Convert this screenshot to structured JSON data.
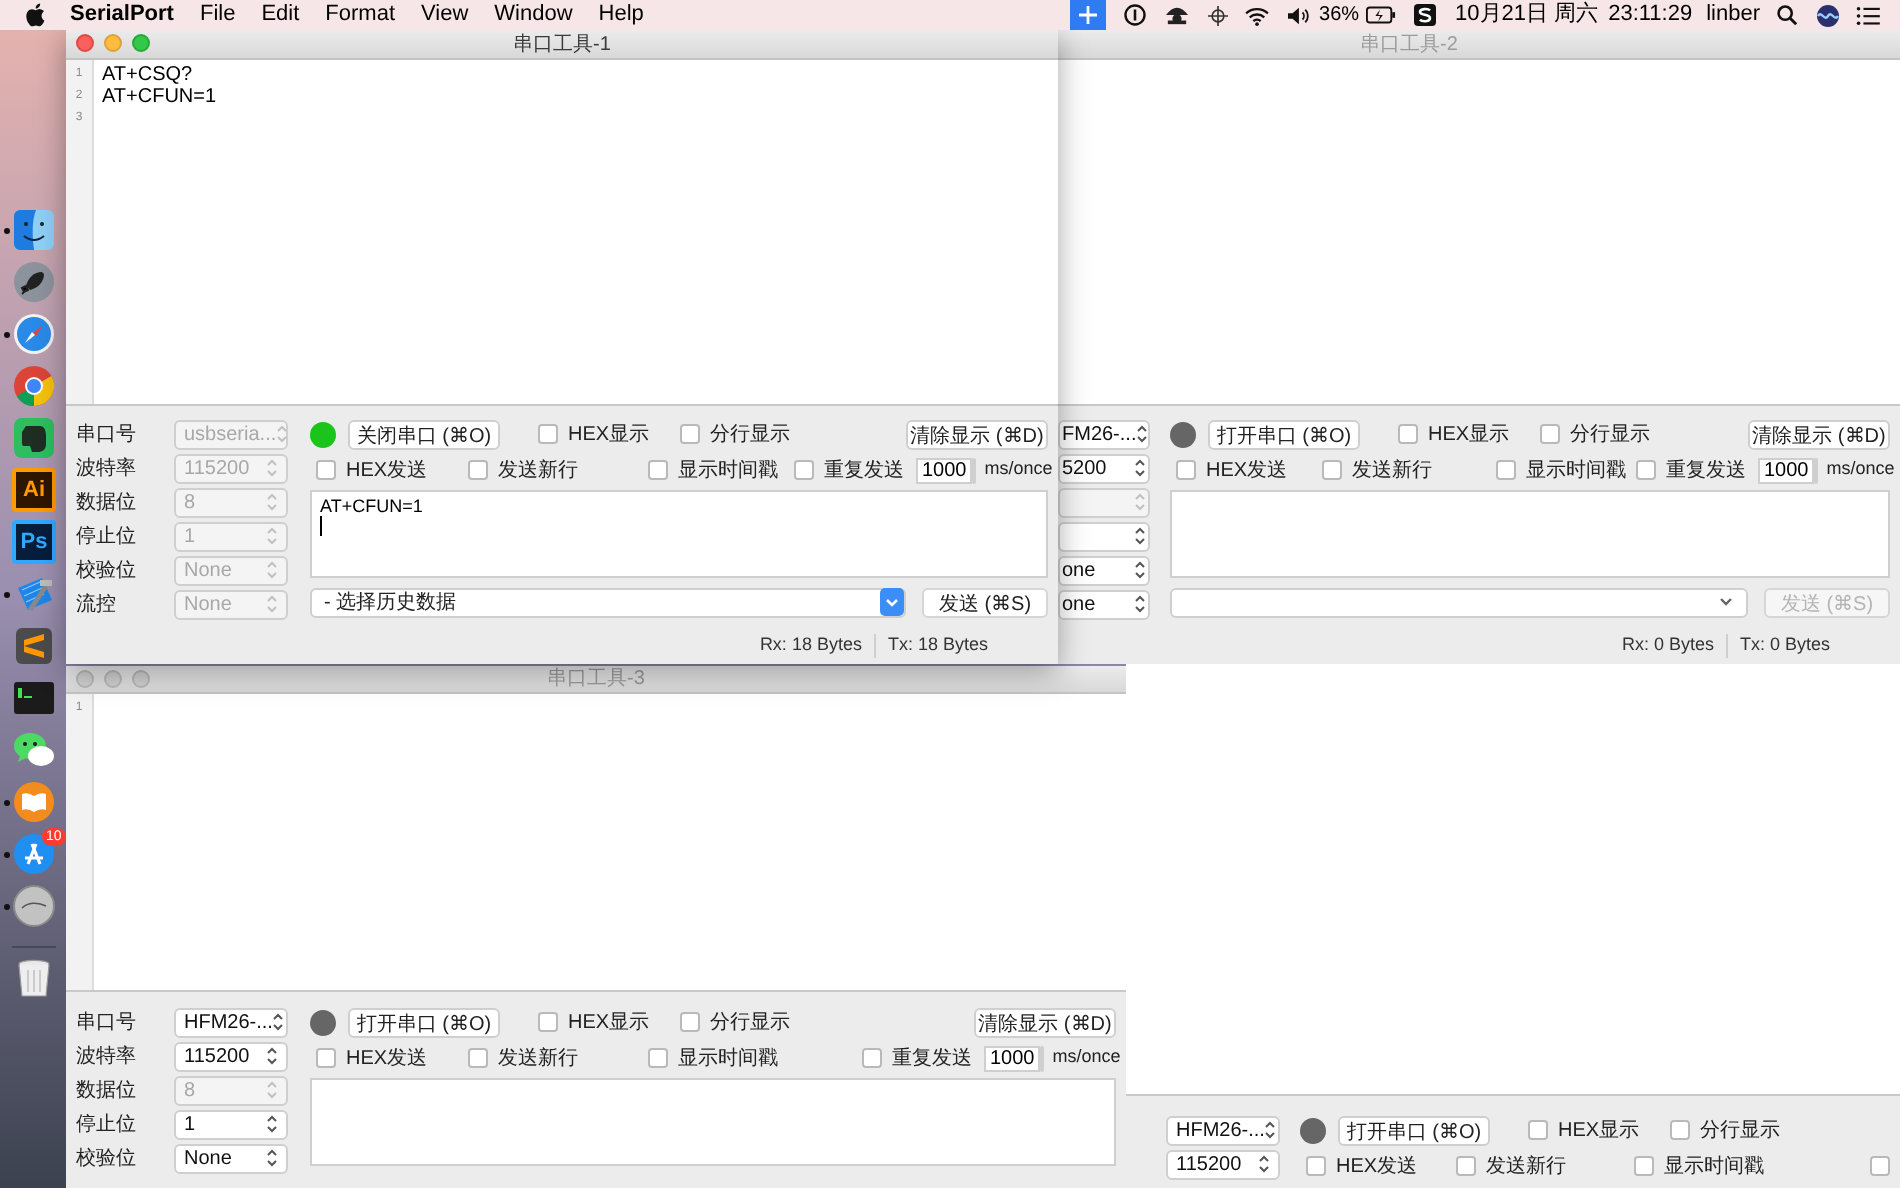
{
  "menu_bar": {
    "app_name": "SerialPort",
    "menus": [
      "File",
      "Edit",
      "Format",
      "View",
      "Window",
      "Help"
    ],
    "battery_percent": "36%",
    "date": "10月21日 周六",
    "time": "23:11:29",
    "user": "linber"
  },
  "dock": {
    "items": [
      {
        "kind": "finder",
        "running": true
      },
      {
        "kind": "launchpad",
        "running": false
      },
      {
        "kind": "safari",
        "running": true
      },
      {
        "kind": "chrome",
        "running": false
      },
      {
        "kind": "evernote",
        "running": false
      },
      {
        "kind": "illustrator",
        "label": "Ai",
        "running": false
      },
      {
        "kind": "photoshop",
        "label": "Ps",
        "running": false
      },
      {
        "kind": "xcode",
        "running": true
      },
      {
        "kind": "sublime",
        "running": false
      },
      {
        "kind": "terminal",
        "running": false
      },
      {
        "kind": "wechat",
        "running": false
      },
      {
        "kind": "books",
        "running": true
      },
      {
        "kind": "appstore",
        "running": true,
        "badge": "10"
      },
      {
        "kind": "serialport",
        "running": true
      },
      {
        "kind": "trash",
        "running": false
      }
    ]
  },
  "windows": [
    {
      "title": "串口工具-1",
      "active": true,
      "editor": {
        "line_numbers": [
          "1",
          "2",
          "3"
        ],
        "lines": [
          "AT+CSQ?",
          "AT+CFUN=1"
        ]
      },
      "settings": [
        {
          "label": "串口号",
          "value": "usbseria...",
          "disabled": true
        },
        {
          "label": "波特率",
          "value": "115200",
          "disabled": true
        },
        {
          "label": "数据位",
          "value": "8",
          "disabled": true
        },
        {
          "label": "停止位",
          "value": "1",
          "disabled": true
        },
        {
          "label": "校验位",
          "value": "None",
          "disabled": true
        },
        {
          "label": "流控",
          "value": "None",
          "disabled": true
        }
      ],
      "port_open": true,
      "port_button": "关闭串口 (⌘O)",
      "display_options": [
        {
          "label": "HEX显示",
          "checked": false
        },
        {
          "label": "分行显示",
          "checked": false
        }
      ],
      "clear_button": "清除显示 (⌘D)",
      "send_options": [
        {
          "label": "HEX发送",
          "checked": false
        },
        {
          "label": "发送新行",
          "checked": false
        },
        {
          "label": "显示时间戳",
          "checked": false
        }
      ],
      "repeat_send": {
        "label": "重复发送",
        "checked": false
      },
      "interval": "1000",
      "interval_unit": "ms/once",
      "send_text": "AT+CFUN=1",
      "history_value": "- 选择历史数据",
      "send_button": {
        "label": "发送 (⌘S)",
        "disabled": false
      },
      "rx": "Rx: 18 Bytes",
      "tx": "Tx: 18 Bytes"
    },
    {
      "title": "串口工具-2",
      "active": false,
      "settings": [
        {
          "value": "FM26-...",
          "disabled": false
        },
        {
          "value": "5200",
          "disabled": false
        },
        {
          "disabled": true
        },
        {
          "disabled": false
        },
        {
          "value": "one",
          "disabled": false
        },
        {
          "value": "one",
          "disabled": false
        }
      ],
      "port_open": false,
      "port_button": "打开串口 (⌘O)",
      "display_options": [
        {
          "label": "HEX显示",
          "checked": false
        },
        {
          "label": "分行显示",
          "checked": false
        }
      ],
      "clear_button": "清除显示 (⌘D)",
      "send_options": [
        {
          "label": "HEX发送",
          "checked": false
        },
        {
          "label": "发送新行",
          "checked": false
        },
        {
          "label": "显示时间戳",
          "checked": false
        }
      ],
      "repeat_send": {
        "label": "重复发送",
        "checked": false
      },
      "interval": "1000",
      "interval_unit": "ms/once",
      "send_button": {
        "label": "发送 (⌘S)",
        "disabled": true
      },
      "rx": "Rx: 0 Bytes",
      "tx": "Tx: 0 Bytes"
    },
    {
      "title": "串口工具-3",
      "active": false,
      "editor": {
        "line_numbers": [
          "1"
        ]
      },
      "settings": [
        {
          "label": "串口号",
          "value": "HFM26-...",
          "disabled": false
        },
        {
          "label": "波特率",
          "value": "115200",
          "disabled": false
        },
        {
          "label": "数据位",
          "value": "8",
          "disabled": true
        },
        {
          "label": "停止位",
          "value": "1",
          "disabled": false
        },
        {
          "label": "校验位",
          "value": "None",
          "disabled": false
        }
      ],
      "port_open": false,
      "port_button": "打开串口 (⌘O)",
      "display_options": [
        {
          "label": "HEX显示",
          "checked": false
        },
        {
          "label": "分行显示",
          "checked": false
        }
      ],
      "clear_button": "清除显示 (⌘D)",
      "send_options": [
        {
          "label": "HEX发送",
          "checked": false
        },
        {
          "label": "发送新行",
          "checked": false
        },
        {
          "label": "显示时间戳",
          "checked": false
        }
      ],
      "repeat_send": {
        "label": "重复发送",
        "checked": false
      },
      "interval": "1000",
      "interval_unit": "ms/once"
    },
    {
      "settings": [
        {
          "value": "HFM26-...",
          "disabled": false
        },
        {
          "value": "115200",
          "disabled": false
        }
      ],
      "port_open": false,
      "port_button": "打开串口 (⌘O)",
      "display_options": [
        {
          "label": "HEX显示",
          "checked": false
        },
        {
          "label": "分行显示",
          "checked": false
        }
      ],
      "send_options": [
        {
          "label": "HEX发送",
          "checked": false
        },
        {
          "label": "发送新行",
          "checked": false
        },
        {
          "label": "显示时间戳",
          "checked": false
        }
      ],
      "repeat_send": {
        "checked": false
      }
    }
  ]
}
